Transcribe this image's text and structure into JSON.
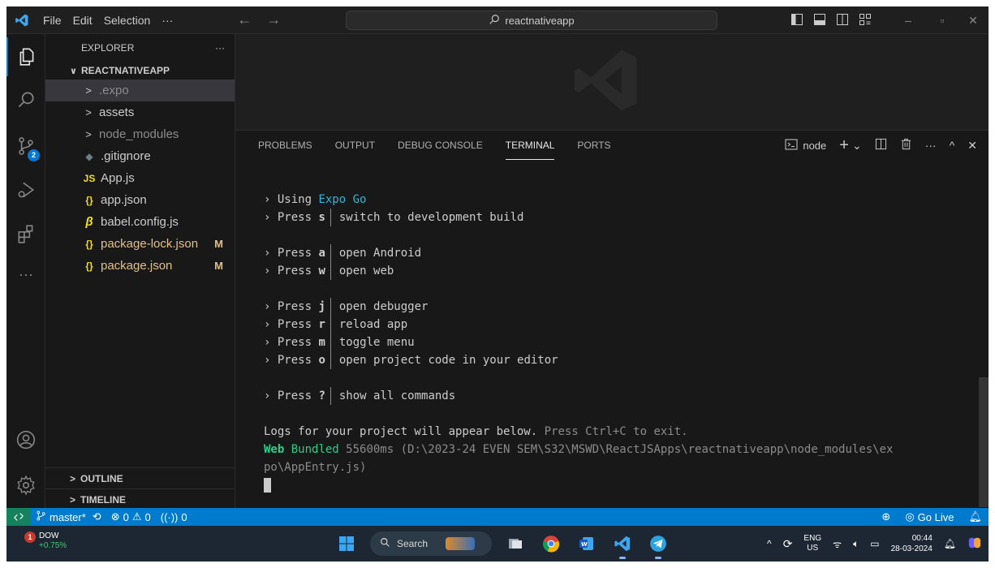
{
  "titlebar": {
    "menu": [
      "File",
      "Edit",
      "Selection",
      "···"
    ],
    "nav_back": "←",
    "nav_forward": "→",
    "search_text": "reactnativeapp",
    "window_controls": [
      "–",
      "▫",
      "✕"
    ]
  },
  "activitybar": {
    "items": [
      "explorer-icon",
      "search-icon",
      "source-control-icon",
      "run-debug-icon",
      "extensions-icon",
      "more-icon",
      "account-icon",
      "manage-icon"
    ],
    "source_control_badge": "2",
    "more_label": "···"
  },
  "sidebar": {
    "header": "EXPLORER",
    "header_more": "···",
    "project": "REACTNATIVEAPP",
    "items": [
      {
        "label": ".expo",
        "type": "folder",
        "icon": ">",
        "selected": true,
        "dim": true,
        "mark": ""
      },
      {
        "label": "assets",
        "type": "folder",
        "icon": ">",
        "selected": false,
        "dim": false,
        "mark": ""
      },
      {
        "label": "node_modules",
        "type": "folder",
        "icon": ">",
        "selected": false,
        "dim": true,
        "mark": ""
      },
      {
        "label": ".gitignore",
        "type": "file",
        "icon": "◆",
        "selected": false,
        "dim": false,
        "mark": ""
      },
      {
        "label": "App.js",
        "type": "file",
        "icon": "JS",
        "selected": false,
        "dim": false,
        "mark": ""
      },
      {
        "label": "app.json",
        "type": "file",
        "icon": "{}",
        "selected": false,
        "dim": false,
        "mark": ""
      },
      {
        "label": "babel.config.js",
        "type": "file",
        "icon": "β",
        "selected": false,
        "dim": false,
        "mark": ""
      },
      {
        "label": "package-lock.json",
        "type": "file",
        "icon": "{}",
        "selected": false,
        "dim": false,
        "mark": "M"
      },
      {
        "label": "package.json",
        "type": "file",
        "icon": "{}",
        "selected": false,
        "dim": false,
        "mark": "M"
      }
    ],
    "outline": "OUTLINE",
    "timeline": "TIMELINE"
  },
  "panel": {
    "tabs": [
      "PROBLEMS",
      "OUTPUT",
      "DEBUG CONSOLE",
      "TERMINAL",
      "PORTS"
    ],
    "active_tab": "TERMINAL",
    "terminal_name": "node",
    "actions": [
      "+",
      "⌄",
      "◫",
      "🗑",
      "···",
      "^",
      "✕"
    ]
  },
  "terminal": {
    "using_prefix": "› Using ",
    "using_value": "Expo Go",
    "commands_group1": [
      {
        "key": "s",
        "desc": "switch to development build"
      }
    ],
    "commands_group2": [
      {
        "key": "a",
        "desc": "open Android"
      },
      {
        "key": "w",
        "desc": "open web"
      }
    ],
    "commands_group3": [
      {
        "key": "j",
        "desc": "open debugger"
      },
      {
        "key": "r",
        "desc": "reload app"
      },
      {
        "key": "m",
        "desc": "toggle menu"
      },
      {
        "key": "o",
        "desc": "open project code in your editor"
      }
    ],
    "commands_group4": [
      {
        "key": "?",
        "desc": "show all commands"
      }
    ],
    "press_prefix": "› Press ",
    "logs_text": "Logs for your project will appear below.",
    "logs_hint": " Press Ctrl+C to exit.",
    "bundled_web": "Web",
    "bundled_word": " Bundled",
    "bundled_rest": " 55600ms (D:\\2023-24 EVEN SEM\\S32\\MSWD\\ReactJSApps\\reactnativeapp\\node_modules\\ex",
    "bundled_cont": "po\\AppEntry.js)"
  },
  "statusbar": {
    "branch": "master*",
    "errors": "0",
    "warnings": "0",
    "ports": "0",
    "go_live": "Go Live"
  },
  "taskbar": {
    "weather_badge": "1",
    "weather_title": "DOW",
    "weather_value": "+0.75%",
    "search_label": "Search",
    "lang_top": "ENG",
    "lang_bottom": "US",
    "time": "00:44",
    "date": "28-03-2024"
  },
  "colors": {
    "accent": "#0078d4",
    "statusbar": "#007acc",
    "remote": "#16825d",
    "modified": "#e2c08d",
    "expo_link": "#29b8db",
    "web_bundled": "#23d18b"
  }
}
